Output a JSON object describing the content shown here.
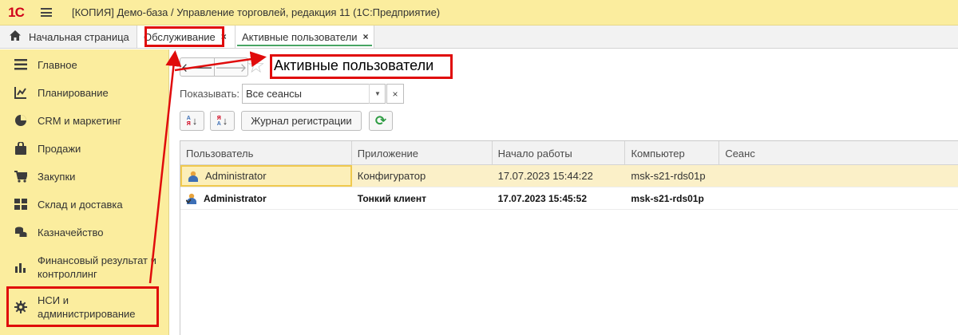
{
  "titlebar": {
    "logo": "1С",
    "menu_icon": "hamburger-icon",
    "title": "[КОПИЯ] Демо-база / Управление торговлей, редакция 11  (1С:Предприятие)"
  },
  "tabs": [
    {
      "label": "Начальная страница",
      "icon": "home-icon"
    },
    {
      "label": "Обслуживание",
      "close": "×"
    },
    {
      "label": "Активные пользователи",
      "close": "×",
      "active": true
    }
  ],
  "sidebar": {
    "items": [
      {
        "label": "Главное",
        "icon": "list-icon"
      },
      {
        "label": "Планирование",
        "icon": "planning-icon"
      },
      {
        "label": "CRM и маркетинг",
        "icon": "pie-chart-icon"
      },
      {
        "label": "Продажи",
        "icon": "shopping-bag-icon"
      },
      {
        "label": "Закупки",
        "icon": "cart-icon"
      },
      {
        "label": "Склад и доставка",
        "icon": "warehouse-icon"
      },
      {
        "label": "Казначейство",
        "icon": "coins-icon"
      },
      {
        "label": "Финансовый результат и контроллинг",
        "label_line1": "Финансовый результат и",
        "label_line2": "контроллинг",
        "icon": "bar-chart-icon"
      },
      {
        "label": "НСИ и администрирование",
        "label_line1": "НСИ и",
        "label_line2": "администрирование",
        "icon": "gear-icon"
      }
    ]
  },
  "main": {
    "title": "Активные пользователи",
    "nav": {
      "back": "🡐",
      "forward": "🡒"
    },
    "filter": {
      "label": "Показывать:",
      "value": "Все сеансы",
      "clear": "×"
    },
    "toolbar": {
      "sort_asc": {
        "top": "А",
        "bottom": "Я"
      },
      "sort_desc": {
        "top": "Я",
        "bottom": "А"
      },
      "journal_label": "Журнал регистрации",
      "refresh": "⟳"
    },
    "table": {
      "columns": [
        "Пользователь",
        "Приложение",
        "Начало работы",
        "Компьютер",
        "Сеанс"
      ],
      "rows": [
        {
          "user": "Administrator",
          "app": "Конфигуратор",
          "start": "17.07.2023 15:44:22",
          "computer": "msk-s21-rds01p",
          "session": "",
          "selected": true,
          "bold": false
        },
        {
          "user": "Administrator",
          "app": "Тонкий клиент",
          "start": "17.07.2023 15:45:52",
          "computer": "msk-s21-rds01p",
          "session": "",
          "selected": false,
          "bold": true
        }
      ]
    }
  },
  "colors": {
    "sidebar_bg": "#fbed9e",
    "accent_green": "#48a563",
    "annotation_red": "#e00b0b",
    "selected_row": "#fbf0c8"
  }
}
